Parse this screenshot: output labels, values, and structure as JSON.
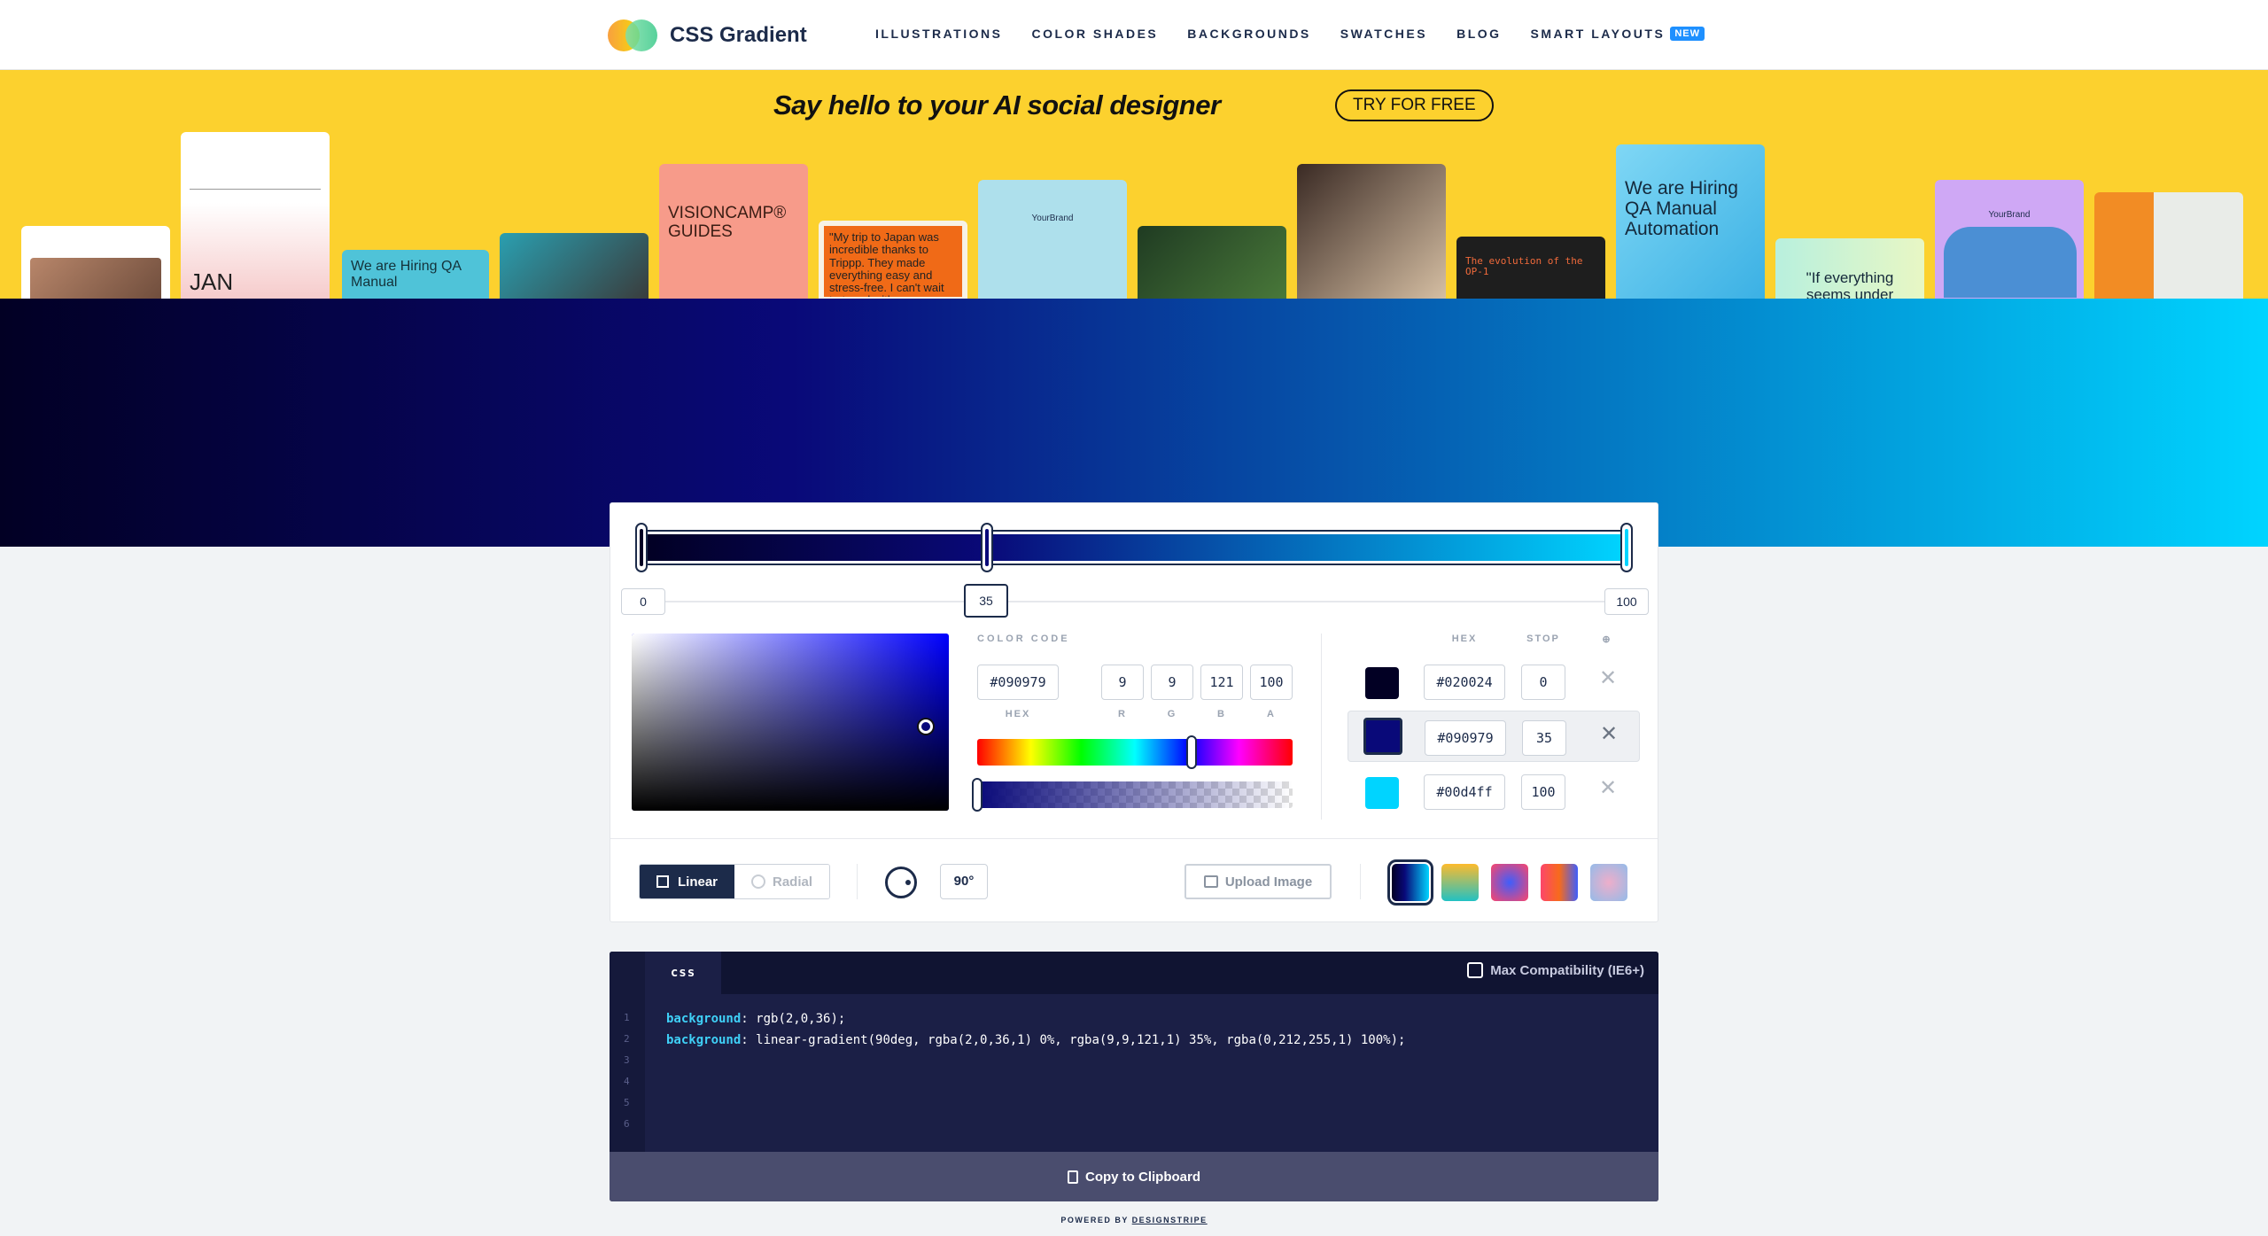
{
  "header": {
    "logo_text": "CSS Gradient",
    "nav": [
      {
        "label": "ILLUSTRATIONS"
      },
      {
        "label": "COLOR SHADES"
      },
      {
        "label": "BACKGROUNDS"
      },
      {
        "label": "SWATCHES"
      },
      {
        "label": "BLOG"
      },
      {
        "label": "SMART LAYOUTS",
        "badge": "NEW"
      }
    ]
  },
  "banner": {
    "title": "Say hello to your AI social designer",
    "cta": "TRY FOR FREE",
    "cards": [
      {
        "text": ""
      },
      {
        "text": "JAN"
      },
      {
        "text": "We are Hiring QA Manual"
      },
      {
        "text": ""
      },
      {
        "text": "VISIONCAMP® GUIDES"
      },
      {
        "text": "\"My trip to Japan was incredible thanks to Trippp. They made everything easy and stress-free. I can't wait to travel with"
      },
      {
        "text": "YourBrand"
      },
      {
        "text": ""
      },
      {
        "text": ""
      },
      {
        "text": "The evolution of the OP-1"
      },
      {
        "text": "We are Hiring QA Manual Automation"
      },
      {
        "text": "\"If everything seems under"
      },
      {
        "text": "YourBrand"
      },
      {
        "text": ""
      }
    ]
  },
  "gradient": {
    "stops": [
      {
        "hex": "#020024",
        "stop": "0",
        "color": "#020024"
      },
      {
        "hex": "#090979",
        "stop": "35",
        "color": "#090979"
      },
      {
        "hex": "#00d4ff",
        "stop": "100",
        "color": "#00d4ff"
      }
    ],
    "selected_stop": "35"
  },
  "picker": {
    "color_code_label": "COLOR CODE",
    "hex": "#090979",
    "r": "9",
    "g": "9",
    "b": "121",
    "a": "100",
    "labels": {
      "hex": "HEX",
      "r": "R",
      "g": "G",
      "b": "B",
      "a": "A"
    },
    "table_headers": {
      "hex": "HEX",
      "stop": "STOP",
      "delete": "⊕"
    }
  },
  "controls": {
    "linear": "Linear",
    "radial": "Radial",
    "angle": "90°",
    "upload": "Upload Image",
    "presets": [
      {
        "name": "preset-1"
      },
      {
        "name": "preset-2"
      },
      {
        "name": "preset-3"
      },
      {
        "name": "preset-4"
      },
      {
        "name": "preset-5"
      }
    ]
  },
  "code": {
    "tab": "css",
    "compat_label": "Max Compatibility (IE6+)",
    "lines": [
      {
        "n": "1",
        "prop": "background",
        "value": ": rgb(2,0,36);"
      },
      {
        "n": "2",
        "prop": "background",
        "value": ": linear-gradient(90deg, rgba(2,0,36,1) 0%, rgba(9,9,121,1) 35%, rgba(0,212,255,1) 100%);"
      },
      {
        "n": "3",
        "prop": "",
        "value": ""
      },
      {
        "n": "4",
        "prop": "",
        "value": ""
      },
      {
        "n": "5",
        "prop": "",
        "value": ""
      },
      {
        "n": "6",
        "prop": "",
        "value": ""
      }
    ],
    "copy_label": "Copy to Clipboard"
  },
  "footer": {
    "powered_prefix": "POWERED BY",
    "powered_brand": "DESIGNSTRIPE"
  }
}
